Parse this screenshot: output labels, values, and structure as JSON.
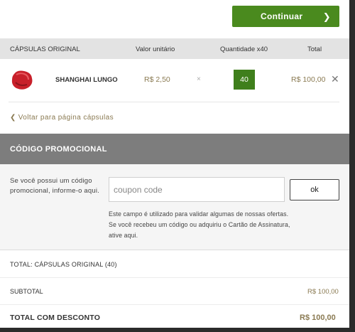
{
  "header": {
    "continue_label": "Continuar",
    "continue_icon": "chevron-right-icon"
  },
  "table": {
    "columns": [
      "CÁPSULAS ORIGINAL",
      "Valor unitário",
      "Quantidade x40",
      "Total"
    ],
    "rows": [
      {
        "name": "SHANGHAI LUNGO",
        "unit_price": "R$ 2,50",
        "times": "×",
        "quantity": "40",
        "total": "R$ 100,00",
        "capsule_color": "#c8202a"
      }
    ]
  },
  "back_link": "Voltar para página cápsulas",
  "promo": {
    "title": "CÓDIGO PROMOCIONAL",
    "description": "Se você possui um código promocional, informe-o aqui.",
    "input_value": "",
    "input_placeholder": "coupon code",
    "ok_label": "ok",
    "note": "Este campo é utilizado para validar algumas de nossas ofertas. Se você recebeu um código ou adquiriu o Cartão de Assinatura, ative aqui."
  },
  "summary": {
    "total_label": "TOTAL: CÁPSULAS ORIGINAL (40)",
    "subtotal_label": "SUBTOTAL",
    "subtotal_value": "R$ 100,00",
    "grand_label": "TOTAL COM DESCONTO",
    "grand_value": "R$ 100,00"
  },
  "colors": {
    "accent_green": "#4a8a1e",
    "price_gold": "#8a7a52",
    "header_gray": "#7d7d7d"
  }
}
